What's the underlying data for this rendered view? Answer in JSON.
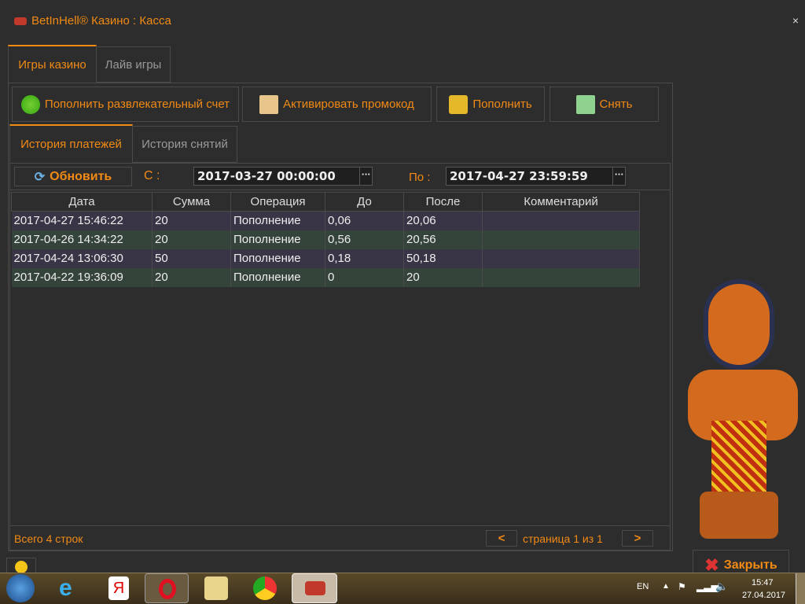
{
  "window": {
    "title": "BetInHell® Казино : Касса",
    "close": "×"
  },
  "main_tabs": [
    {
      "label": "Игры казино",
      "active": true
    },
    {
      "label": "Лайв игры",
      "active": false
    }
  ],
  "toolbar": {
    "deposit_fun": "Пополнить развлекательный счет",
    "promo": "Активировать промокод",
    "deposit": "Пополнить",
    "withdraw": "Снять"
  },
  "sub_tabs": [
    {
      "label": "История платежей",
      "active": true
    },
    {
      "label": "История снятий",
      "active": false
    }
  ],
  "filter": {
    "refresh": "Обновить",
    "from_label": "С :",
    "from_value": "2017-03-27 00:00:00",
    "to_label": "По :",
    "to_value": "2017-04-27 23:59:59",
    "picker": "···"
  },
  "table": {
    "columns": [
      "Дата",
      "Сумма",
      "Операция",
      "До",
      "После",
      "Комментарий"
    ],
    "rows": [
      [
        "2017-04-27 15:46:22",
        "20",
        "Пополнение",
        "0,06",
        "20,06",
        ""
      ],
      [
        "2017-04-26 14:34:22",
        "20",
        "Пополнение",
        "0,56",
        "20,56",
        ""
      ],
      [
        "2017-04-24 13:06:30",
        "50",
        "Пополнение",
        "0,18",
        "50,18",
        ""
      ],
      [
        "2017-04-22 19:36:09",
        "20",
        "Пополнение",
        "0",
        "20",
        ""
      ]
    ]
  },
  "footer": {
    "total": "Всего 4 строк",
    "prev": "<",
    "page": "страница 1 из 1",
    "next": ">"
  },
  "close_button": "Закрыть",
  "taskbar": {
    "lang": "EN",
    "time": "15:47",
    "date": "27.04.2017"
  },
  "colors": {
    "accent": "#f28a14",
    "row_odd": "#3a3546",
    "row_even": "#34443b"
  }
}
